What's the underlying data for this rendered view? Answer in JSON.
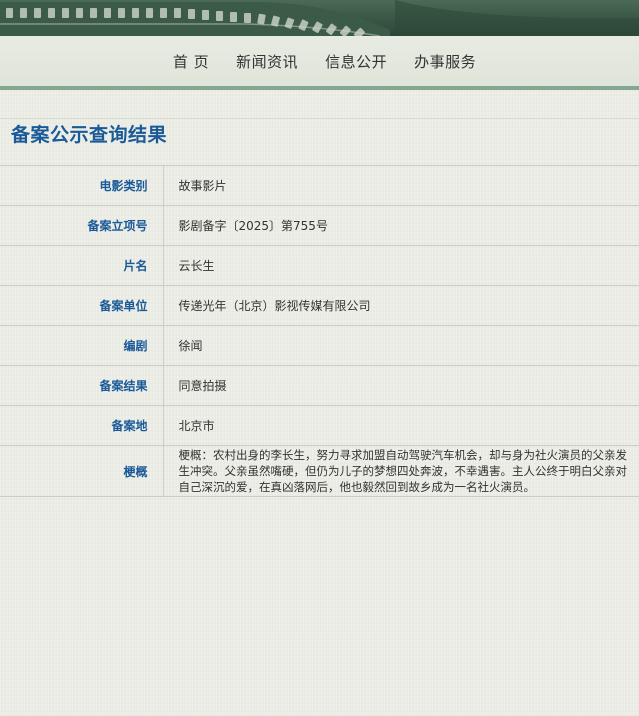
{
  "nav": {
    "items": [
      {
        "label": "首 页"
      },
      {
        "label": "新闻资讯"
      },
      {
        "label": "信息公开"
      },
      {
        "label": "办事服务"
      }
    ]
  },
  "page": {
    "title": "备案公示查询结果"
  },
  "record": {
    "rows": [
      {
        "label": "电影类别",
        "value": "故事影片"
      },
      {
        "label": "备案立项号",
        "value": "影剧备字〔2025〕第755号"
      },
      {
        "label": "片名",
        "value": "云长生"
      },
      {
        "label": "备案单位",
        "value": "传递光年（北京）影视传媒有限公司"
      },
      {
        "label": "编剧",
        "value": "徐闻"
      },
      {
        "label": "备案结果",
        "value": "同意拍摄"
      },
      {
        "label": "备案地",
        "value": "北京市"
      },
      {
        "label": "梗概",
        "value": "梗概：农村出身的李长生，努力寻求加盟自动驾驶汽车机会，却与身为社火演员的父亲发生冲突。父亲虽然嘴硬，但仍为儿子的梦想四处奔波，不幸遇害。主人公终于明白父亲对自己深沉的爱，在真凶落网后，他也毅然回到故乡成为一名社火演员。"
      }
    ]
  },
  "colors": {
    "accent_blue": "#1a5a98",
    "banner_green": "#2f4a3a",
    "nav_rule_green": "#86a690"
  }
}
